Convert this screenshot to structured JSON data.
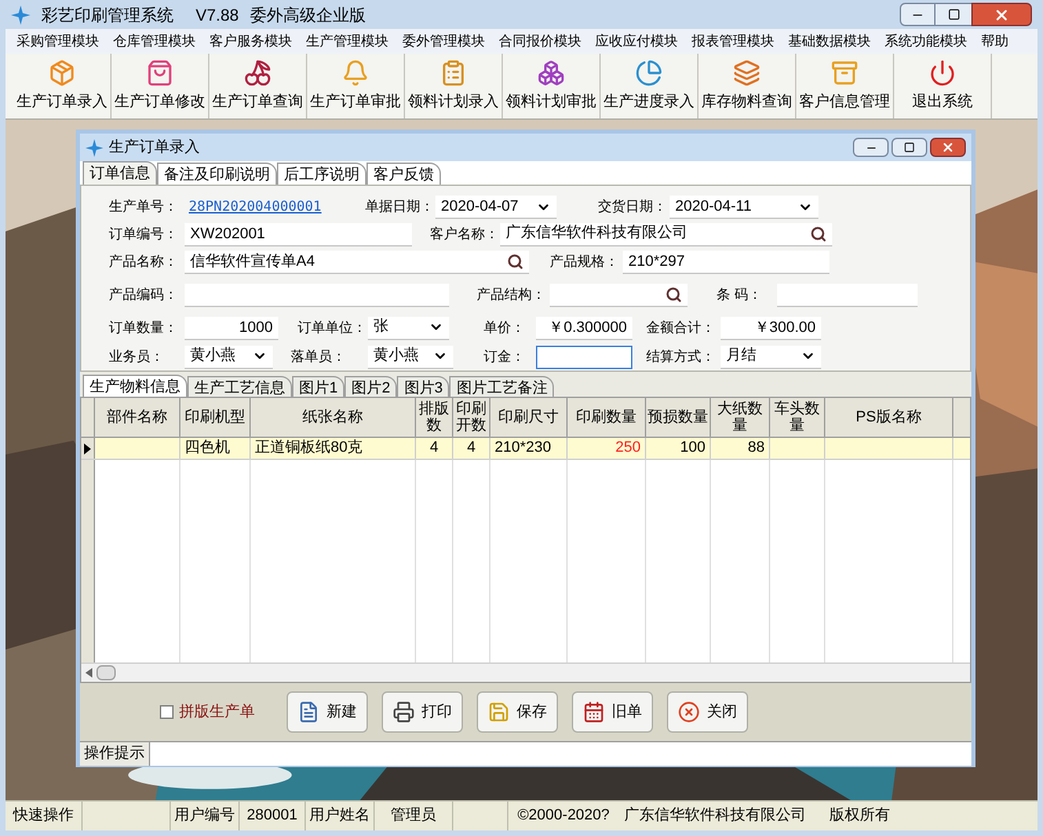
{
  "window": {
    "title": "彩艺印刷管理系统",
    "version": "V7.88",
    "edition": "委外高级企业版"
  },
  "menu": [
    "采购管理模块",
    "仓库管理模块",
    "客户服务模块",
    "生产管理模块",
    "委外管理模块",
    "合同报价模块",
    "应收应付模块",
    "报表管理模块",
    "基础数据模块",
    "系统功能模块",
    "帮助"
  ],
  "toolbar": [
    "生产订单录入",
    "生产订单修改",
    "生产订单查询",
    "生产订单审批",
    "领料计划录入",
    "领料计划审批",
    "生产进度录入",
    "库存物料查询",
    "客户信息管理",
    "退出系统"
  ],
  "child_window": {
    "title": "生产订单录入",
    "tabs": [
      {
        "label": "订单信息",
        "selected": true
      },
      {
        "label": "备注及印刷说明",
        "selected": false
      },
      {
        "label": "后工序说明",
        "selected": false
      },
      {
        "label": "客户反馈",
        "selected": false
      }
    ],
    "form": [
      [
        {
          "label": "生产单号：",
          "kind": "link",
          "value": "28PN202004000001"
        },
        {
          "label": "单据日期：",
          "kind": "dropdown",
          "value": "2020-04-07"
        },
        {
          "label": "交货日期：",
          "kind": "dropdown",
          "value": "2020-04-11"
        }
      ],
      [
        {
          "label": "订单编号：",
          "kind": "text",
          "value": "XW202001"
        },
        {
          "label": "客户名称：",
          "kind": "lookup",
          "value": "广东信华软件科技有限公司"
        }
      ],
      [
        {
          "label": "产品名称：",
          "kind": "lookup",
          "value": "信华软件宣传单A4"
        },
        {
          "label": "产品规格：",
          "kind": "text",
          "value": "210*297"
        }
      ],
      [
        {
          "label": "产品编码：",
          "kind": "text"
        },
        {
          "label": "产品结构：",
          "kind": "lookup"
        },
        {
          "label": "条 码：",
          "kind": "text"
        }
      ],
      [
        {
          "label": "订单数量：",
          "kind": "number",
          "value": "1000"
        },
        {
          "label": "订单单位：",
          "kind": "dropdown",
          "value": "张"
        },
        {
          "label": "单价：",
          "kind": "number",
          "value": "￥0.300000"
        },
        {
          "label": "金额合计：",
          "kind": "number",
          "value": "￥300.00"
        }
      ],
      [
        {
          "label": "业务员：",
          "kind": "dropdown",
          "value": "黄小燕"
        },
        {
          "label": "落单员：",
          "kind": "dropdown",
          "value": "黄小燕"
        },
        {
          "label": "订金：",
          "kind": "text",
          "focused": true
        },
        {
          "label": "结算方式：",
          "kind": "dropdown",
          "value": "月结"
        }
      ]
    ],
    "detail_tabs": [
      {
        "label": "生产物料信息",
        "selected": true
      },
      {
        "label": "生产工艺信息",
        "selected": false
      },
      {
        "label": "图片1",
        "selected": false
      },
      {
        "label": "图片2",
        "selected": false
      },
      {
        "label": "图片3",
        "selected": false
      },
      {
        "label": "图片工艺备注",
        "selected": false
      }
    ],
    "table": {
      "columns": [
        "部件名称",
        "印刷机型",
        "纸张名称",
        "排版数",
        "印刷开数",
        "印刷尺寸",
        "印刷数量",
        "预损数量",
        "大纸数量",
        "车头数量",
        "PS版名称"
      ],
      "rows": [
        {
          "current": true,
          "cells": [
            {},
            {
              "text": "四色机"
            },
            {
              "text": "正道铜板纸80克"
            },
            {
              "text": "4"
            },
            {
              "text": "4"
            },
            {
              "text": "210*230"
            },
            {
              "text": "250",
              "alert": true
            },
            {
              "text": "100"
            },
            {
              "text": "88"
            },
            {},
            {}
          ]
        }
      ]
    },
    "imposition_checkbox": {
      "label": "拼版生产单",
      "checked": false
    },
    "buttons": [
      "新建",
      "打印",
      "保存",
      "旧单",
      "关闭"
    ],
    "hint_label": "操作提示"
  },
  "status_bar": {
    "quick_label": "快速操作",
    "user_fields": [
      "用户编号",
      "280001",
      "用户姓名",
      "管理员"
    ],
    "notice": [
      "©2000-2020?",
      "广东信华软件科技有限公司",
      "版权所有"
    ]
  }
}
